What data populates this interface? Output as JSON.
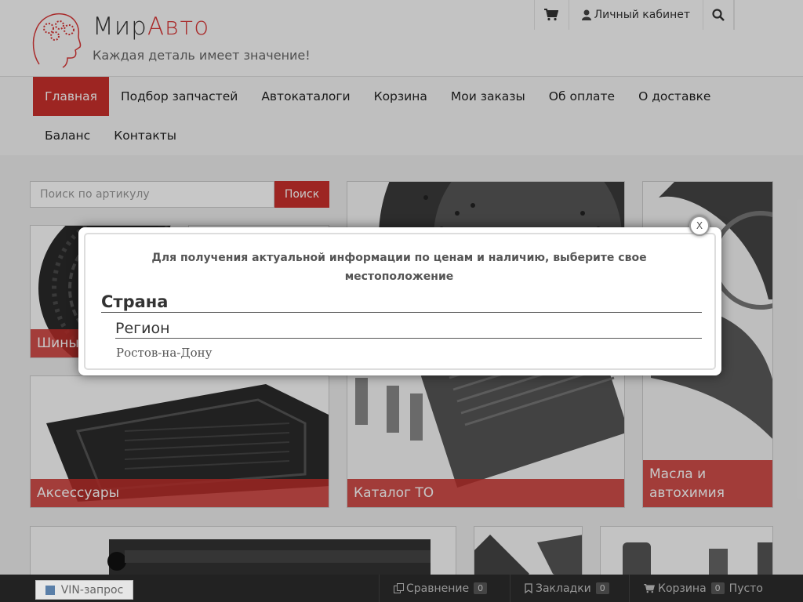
{
  "header": {
    "logo_title_main": "Мир",
    "logo_title_accent": "Авто",
    "slogan": "Каждая деталь имеет значение!",
    "cabinet_label": "Личный кабинет"
  },
  "nav": {
    "row1": [
      "Главная",
      "Подбор запчастей",
      "Автокаталоги",
      "Корзина",
      "Мои заказы",
      "Об оплате",
      "О доставке"
    ],
    "row2": [
      "Баланс",
      "Контакты"
    ]
  },
  "search": {
    "placeholder": "Поиск по артикулу",
    "button": "Поиск"
  },
  "tiles": {
    "tires": "Шины",
    "accessories": "Аксессуары",
    "to_catalog": "Каталог ТО",
    "oils": "Масла и автохимия"
  },
  "modal": {
    "message": "Для получения актуальной информации по ценам и наличию, выберите свое местоположение",
    "country": "Страна",
    "region": "Регион",
    "city": "Ростов-на-Дону",
    "close": "X"
  },
  "bottom_bar": {
    "vin": "VIN-запрос",
    "compare": "Сравнение",
    "compare_count": "0",
    "bookmarks": "Закладки",
    "bookmarks_count": "0",
    "cart": "Корзина",
    "cart_count": "0",
    "cart_status": "Пусто"
  },
  "colors": {
    "accent": "#c9302c",
    "bottom_bar": "#222222"
  }
}
